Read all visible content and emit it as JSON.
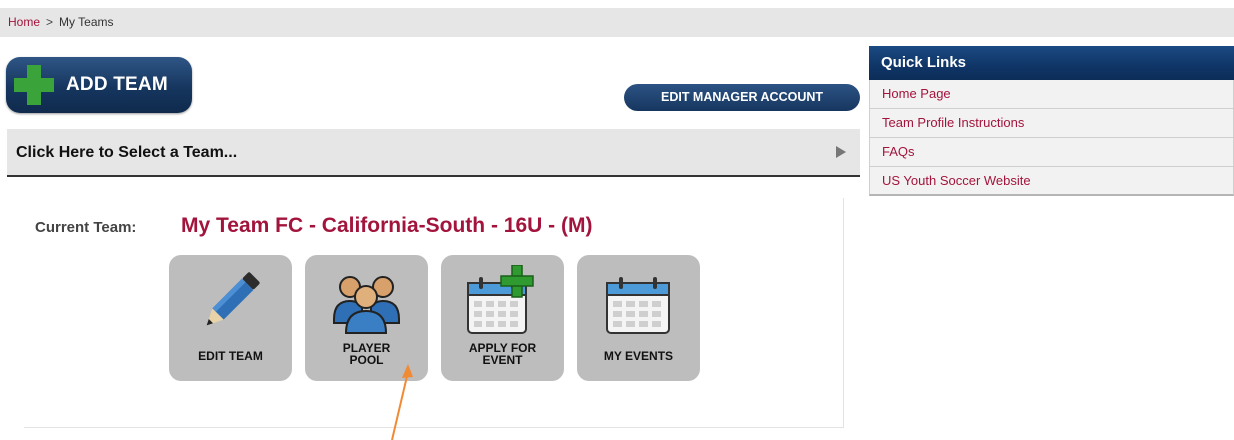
{
  "breadcrumb": {
    "home": "Home",
    "separator": ">",
    "current": "My Teams"
  },
  "actions": {
    "add_team": "ADD TEAM",
    "edit_manager": "EDIT MANAGER ACCOUNT"
  },
  "team_selector": {
    "label": "Click Here to Select a Team..."
  },
  "current_team": {
    "label": "Current Team:",
    "value": "My Team FC - California-South - 16U - (M)"
  },
  "tiles": [
    {
      "line1": "EDIT TEAM",
      "line2": "",
      "icon": "pencil-icon"
    },
    {
      "line1": "PLAYER",
      "line2": "POOL",
      "icon": "players-group-icon"
    },
    {
      "line1": "APPLY FOR",
      "line2": "EVENT",
      "icon": "calendar-add-icon"
    },
    {
      "line1": "MY EVENTS",
      "line2": "",
      "icon": "calendar-icon"
    }
  ],
  "quick_links": {
    "title": "Quick Links",
    "items": [
      "Home Page",
      "Team Profile Instructions",
      "FAQs",
      "US Youth Soccer Website"
    ]
  },
  "colors": {
    "brand_red": "#a3143c",
    "navy": "#16365f",
    "tile_gray": "#bdbdbd",
    "annotation_arrow": "#f08a34"
  }
}
